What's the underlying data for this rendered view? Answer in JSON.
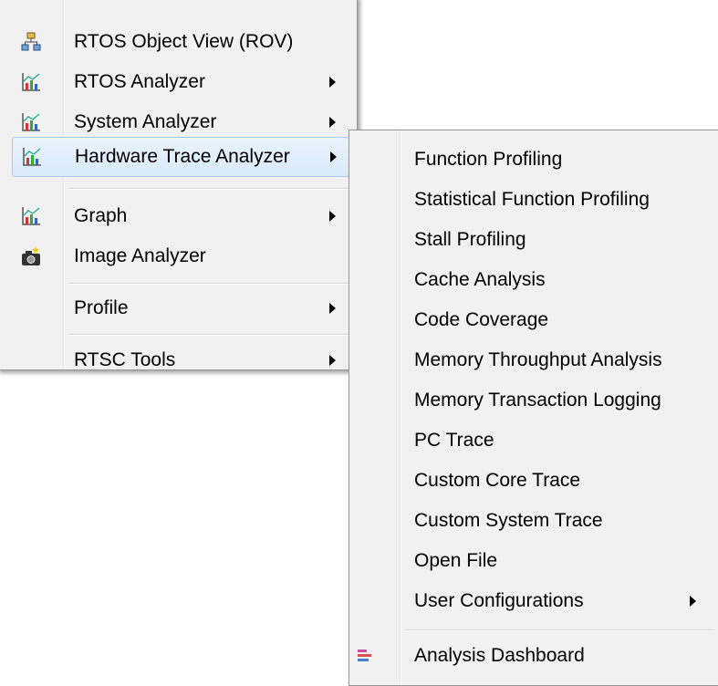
{
  "colors": {
    "menu_background": "#f1f1f1",
    "menu_border": "#979797",
    "highlight_background": "#d9e9fa",
    "highlight_border": "#a8cbf1",
    "separator": "#d7d7d7"
  },
  "main_menu": {
    "items": [
      {
        "label": "RTOS Object View (ROV)",
        "icon": "object-view-icon",
        "submenu": false,
        "highlighted": false
      },
      {
        "label": "RTOS Analyzer",
        "icon": "chart-icon",
        "submenu": true,
        "highlighted": false
      },
      {
        "label": "System Analyzer",
        "icon": "chart-icon",
        "submenu": true,
        "highlighted": false
      },
      {
        "label": "Hardware Trace Analyzer",
        "icon": "chart-icon",
        "submenu": true,
        "highlighted": true
      },
      {
        "label": "Graph",
        "icon": "chart-icon",
        "submenu": true,
        "highlighted": false
      },
      {
        "label": "Image Analyzer",
        "icon": "camera-icon",
        "submenu": false,
        "highlighted": false
      },
      {
        "label": "Profile",
        "icon": "",
        "submenu": true,
        "highlighted": false
      },
      {
        "label": "RTSC Tools",
        "icon": "",
        "submenu": true,
        "highlighted": false
      }
    ]
  },
  "hardware_trace_submenu": {
    "items": [
      {
        "label": "Function Profiling",
        "submenu": false
      },
      {
        "label": "Statistical Function Profiling",
        "submenu": false
      },
      {
        "label": "Stall Profiling",
        "submenu": false
      },
      {
        "label": "Cache Analysis",
        "submenu": false
      },
      {
        "label": "Code Coverage",
        "submenu": false
      },
      {
        "label": "Memory Throughput Analysis",
        "submenu": false
      },
      {
        "label": "Memory Transaction Logging",
        "submenu": false
      },
      {
        "label": "PC Trace",
        "submenu": false
      },
      {
        "label": "Custom Core Trace",
        "submenu": false
      },
      {
        "label": "Custom System Trace",
        "submenu": false
      },
      {
        "label": "Open File",
        "submenu": false
      },
      {
        "label": "User Configurations",
        "submenu": true
      },
      {
        "label": "Analysis Dashboard",
        "icon": "dashboard-icon",
        "submenu": false
      }
    ]
  }
}
